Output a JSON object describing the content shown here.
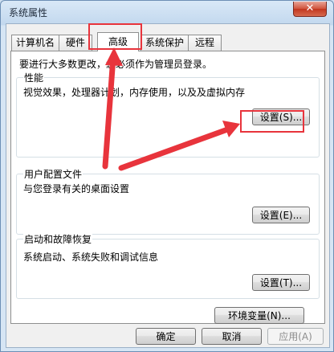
{
  "window": {
    "title": "系统属性",
    "close_label": "✕"
  },
  "tabs": [
    {
      "label": "计算机名"
    },
    {
      "label": "硬件"
    },
    {
      "label": "高级"
    },
    {
      "label": "系统保护"
    },
    {
      "label": "远程"
    }
  ],
  "active_tab": "高级",
  "panel": {
    "intro": "要进行大多数更改，您必须作为管理员登录。",
    "performance": {
      "title": "性能",
      "desc": "视觉效果，处理器计划，内存使用，以及及虚拟内存",
      "button": "设置(S)..."
    },
    "profiles": {
      "title": "用户配置文件",
      "desc": "与您登录有关的桌面设置",
      "button": "设置(E)..."
    },
    "startup": {
      "title": "启动和故障恢复",
      "desc": "系统启动、系统失败和调试信息",
      "button": "设置(T)..."
    },
    "env_button": "环境变量(N)..."
  },
  "footer": {
    "ok": "确定",
    "cancel": "取消",
    "apply": "应用(A)"
  },
  "annotation_color": "#e8343c"
}
